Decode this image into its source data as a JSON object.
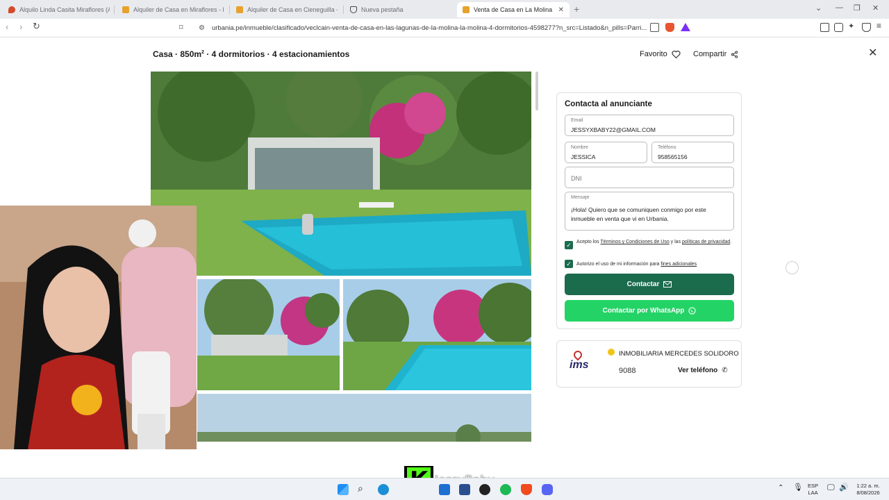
{
  "browser": {
    "tabs": [
      {
        "title": "Alquilo Linda Casita Miraflores (A. C.",
        "favicon_color": "#d44a2a",
        "active": false
      },
      {
        "title": "Alquiler de Casa en Miraflores - Lima",
        "favicon_color": "#e6a22c",
        "active": false
      },
      {
        "title": "Alquiler de Casa en Cieneguilla - Lim",
        "favicon_color": "#e6a22c",
        "active": false
      },
      {
        "title": "Nueva pestaña",
        "favicon_color": "#444444",
        "active": false
      },
      {
        "title": "Venta de Casa en La Molina - Lim",
        "favicon_color": "#e6a22c",
        "active": true
      }
    ],
    "new_tab_symbol": "+",
    "url": "urbania.pe/inmueble/clasificado/veclcain-venta-de-casa-en-las-lagunas-de-la-molina-la-molina-4-dormitorios-4598277?n_src=Listado&n_pills=Parri..."
  },
  "listing": {
    "title_prefix": "Casa · 850m",
    "title_sup": "2",
    "title_suffix": " · 4 dormitorios · 4 estacionamientos",
    "favorite_label": "Favorito",
    "share_label": "Compartir",
    "close_symbol": "✕"
  },
  "contact": {
    "heading": "Contacta al anunciante",
    "email": {
      "label": "Email",
      "value": "JESSYXBABY22@GMAIL.COM"
    },
    "nombre": {
      "label": "Nombre",
      "value": "JESSICA"
    },
    "telefono": {
      "label": "Teléfono",
      "value": "958565156"
    },
    "dni": {
      "placeholder": "DNI"
    },
    "mensaje": {
      "label": "Mensaje",
      "value": "¡Hola! Quiero que se comuniquen conmigo por este inmueble en venta que vi en Urbania."
    },
    "terms": {
      "prefix": "Acepto los ",
      "link1": "Términos y Condiciones de Uso",
      "middle": " y las ",
      "link2": "políticas de privacidad",
      "suffix": "."
    },
    "consent": {
      "prefix": "Autorizo el uso de mi información para ",
      "link": "fines adicionales"
    },
    "contactar_label": "Contactar",
    "whatsapp_label": "Contactar por WhatsApp",
    "colors": {
      "primary": "#1b6b4d",
      "whatsapp": "#24d366"
    }
  },
  "agency": {
    "name": "INMOBILIARIA MERCEDES SOLIDORO",
    "logo_text": "ims",
    "phone_partial": "9088",
    "ver_telefono_label": "Ver teléfono"
  },
  "overlay": {
    "watermark": "JessyBaby",
    "kick_letter": "K"
  },
  "taskbar": {
    "lang_top": "ESP",
    "lang_bottom": "LAA",
    "time": "1:22 a. m.",
    "date": "8/08/2026"
  }
}
